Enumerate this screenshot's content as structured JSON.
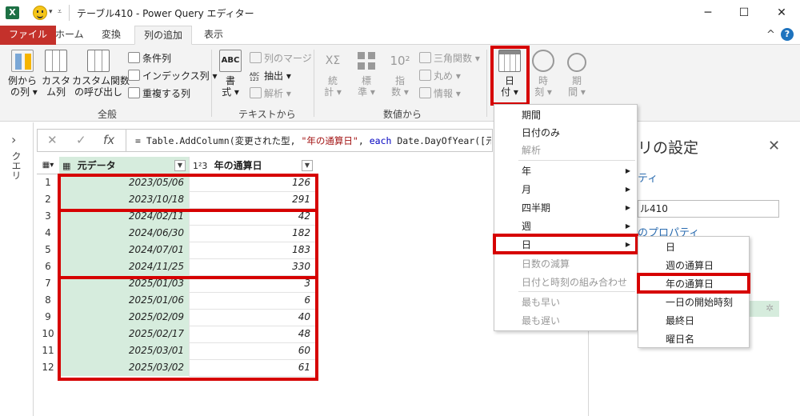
{
  "window": {
    "app_icon": "X",
    "title": "テーブル410 - Power Query エディター",
    "minimize": "─",
    "maximize": "☐",
    "close": "✕"
  },
  "tabs": [
    {
      "label": "ファイル"
    },
    {
      "label": "ホーム"
    },
    {
      "label": "変換"
    },
    {
      "label": "列の追加"
    },
    {
      "label": "表示"
    }
  ],
  "tabs_right": {
    "collapse": "^",
    "help": "?"
  },
  "ribbon": {
    "general": {
      "group_label": "全般",
      "col_from_example": "例から\n の列 ▾",
      "custom_col": "カスタ\nム列",
      "invoke_custom_function": "カスタム関数\nの呼び出し",
      "conditional_col": "条件列",
      "index_col": "インデックス列 ▾",
      "duplicate_col": "重複する列"
    },
    "from_text": {
      "group_label": "テキストから",
      "format": "書\n式 ▾",
      "merge_cols": "列のマージ",
      "extract": "抽出 ▾",
      "parse": "解析 ▾",
      "icon_abc": "ABC",
      "icon_123": "ABC\n123"
    },
    "from_number": {
      "group_label": "数値から",
      "statistics": "統\n計 ▾",
      "standard": "標\n準 ▾",
      "scientific": "指\n数 ▾",
      "trigonometry": "三角関数 ▾",
      "rounding": "丸め ▾",
      "information": "情報 ▾",
      "icon_sigma": "XΣ",
      "icon_power": "10²"
    },
    "from_date": {
      "date": "日\n付 ▾",
      "time": "時\n刻 ▾",
      "duration": "期\n間 ▾"
    }
  },
  "left_panel": {
    "label": "クエリ",
    "chevron": "›"
  },
  "formula_bar": {
    "cancel": "✕",
    "confirm": "✓",
    "fx": "fx",
    "prefix": "= Table.AddColumn(変更された型, ",
    "str": "\"年の通算日\"",
    "mid": ", ",
    "kw": "each",
    "suffix": " Date.DayOfYear([元デ"
  },
  "table": {
    "columns": [
      {
        "type_icon": "▦",
        "name": "元データ"
      },
      {
        "type_icon": "1²3",
        "name": "年の通算日"
      }
    ],
    "rows": [
      {
        "n": "1",
        "date": "2023/05/06",
        "day": "126"
      },
      {
        "n": "2",
        "date": "2023/10/18",
        "day": "291"
      },
      {
        "n": "3",
        "date": "2024/02/11",
        "day": "42"
      },
      {
        "n": "4",
        "date": "2024/06/30",
        "day": "182"
      },
      {
        "n": "5",
        "date": "2024/07/01",
        "day": "183"
      },
      {
        "n": "6",
        "date": "2024/11/25",
        "day": "330"
      },
      {
        "n": "7",
        "date": "2025/01/03",
        "day": "3"
      },
      {
        "n": "8",
        "date": "2025/01/06",
        "day": "6"
      },
      {
        "n": "9",
        "date": "2025/02/09",
        "day": "40"
      },
      {
        "n": "10",
        "date": "2025/02/17",
        "day": "48"
      },
      {
        "n": "11",
        "date": "2025/03/01",
        "day": "60"
      },
      {
        "n": "12",
        "date": "2025/03/02",
        "day": "61"
      }
    ]
  },
  "settings_panel": {
    "title": "リの設定",
    "close": "✕",
    "sub": "ティ",
    "name_value": "ル410",
    "link": "のプロパティ"
  },
  "date_menu": {
    "items": [
      {
        "label": "期間",
        "dim": false,
        "arrow": false
      },
      {
        "label": "日付のみ",
        "dim": false,
        "arrow": false
      },
      {
        "label": "解析",
        "dim": true,
        "arrow": false
      },
      {
        "label": "年",
        "dim": false,
        "arrow": true
      },
      {
        "label": "月",
        "dim": false,
        "arrow": true
      },
      {
        "label": "四半期",
        "dim": false,
        "arrow": true
      },
      {
        "label": "週",
        "dim": false,
        "arrow": true
      },
      {
        "label": "日",
        "dim": false,
        "arrow": true
      },
      {
        "label": "日数の減算",
        "dim": true,
        "arrow": false
      },
      {
        "label": "日付と時刻の組み合わせ",
        "dim": true,
        "arrow": false
      },
      {
        "label": "最も早い",
        "dim": true,
        "arrow": false
      },
      {
        "label": "最も遅い",
        "dim": true,
        "arrow": false
      }
    ],
    "arrow": "▶"
  },
  "day_submenu": {
    "items": [
      {
        "label": "日"
      },
      {
        "label": "週の通算日"
      },
      {
        "label": "年の通算日"
      },
      {
        "label": "一日の開始時刻"
      },
      {
        "label": "最終日"
      },
      {
        "label": "曜日名"
      }
    ]
  },
  "colors": {
    "accent_red": "#d60000",
    "file_tab": "#c4312b",
    "date_column": "#d6ecdd",
    "excel_green": "#1d7044"
  }
}
